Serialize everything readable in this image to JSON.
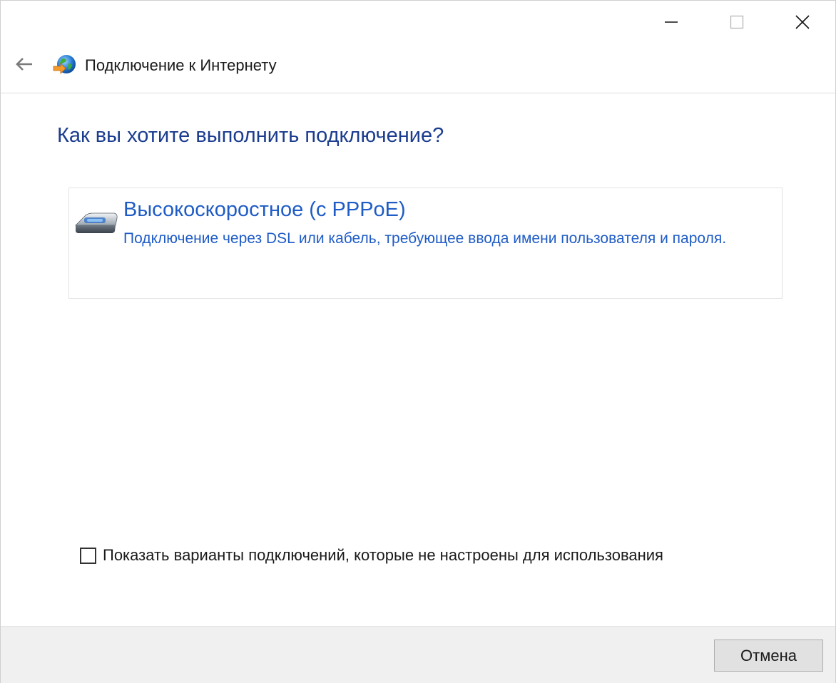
{
  "window": {
    "title": "Подключение к Интернету"
  },
  "caption_buttons": {
    "minimize_icon": "minimize-icon",
    "maximize_icon": "maximize-icon",
    "close_icon": "close-icon"
  },
  "main": {
    "question": "Как вы хотите выполнить подключение?",
    "options": [
      {
        "title": "Высокоскоростное (с PPPoE)",
        "description": "Подключение через DSL или кабель, требующее ввода имени пользователя и пароля.",
        "icon": "modem-icon"
      }
    ],
    "show_unconfigured": {
      "label": "Показать варианты подключений, которые не настроены для использования",
      "checked": false
    }
  },
  "footer": {
    "cancel_label": "Отмена"
  },
  "colors": {
    "heading": "#1b3d8f",
    "link": "#1f5cc6",
    "footer_bg": "#f0f0f0"
  }
}
